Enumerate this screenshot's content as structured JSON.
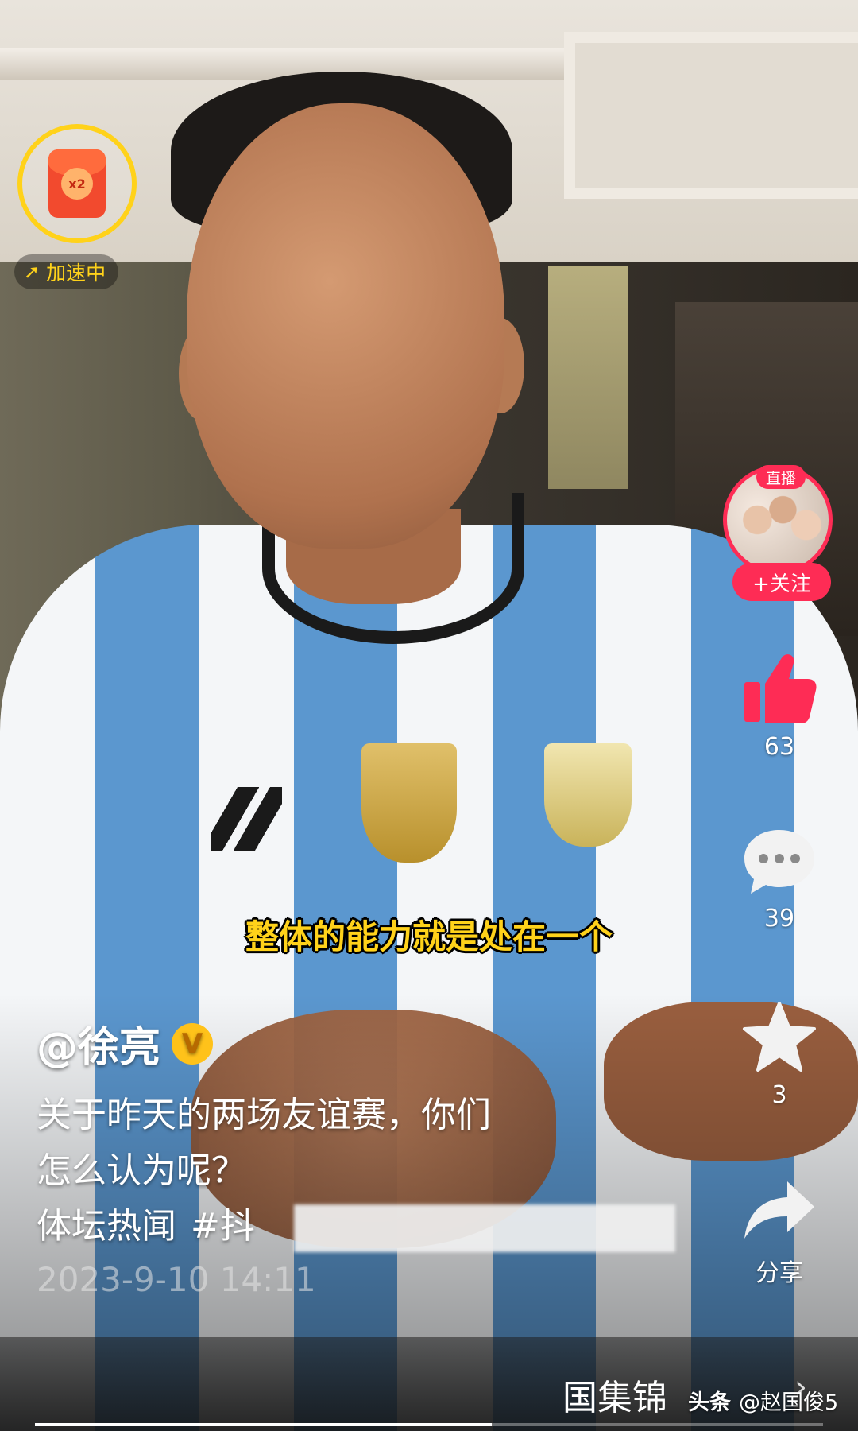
{
  "reward": {
    "multiplier": "x2",
    "status": "加速中"
  },
  "creator": {
    "live_tag": "直播",
    "follow_label": "+关注",
    "name": "@徐亮",
    "verified_mark": "V"
  },
  "actions": {
    "like_count": "63",
    "comment_count": "39",
    "favorite_count": "3",
    "share_label": "分享"
  },
  "video": {
    "subtitle": "整体的能力就是处在一个",
    "description_line1": "关于昨天的两场友谊赛，你们",
    "description_line2": "怎么认为呢？",
    "tag1": "体坛热闻",
    "tag2": "#抖",
    "timestamp": "2023-9-10 14:11",
    "progress_fraction": 0.58
  },
  "bottom": {
    "collection_text": "国集锦",
    "watermark_app": "头条",
    "watermark_user": "@赵国俊5"
  },
  "colors": {
    "accent_red": "#fe2c55",
    "accent_yellow": "#ffd21a"
  }
}
